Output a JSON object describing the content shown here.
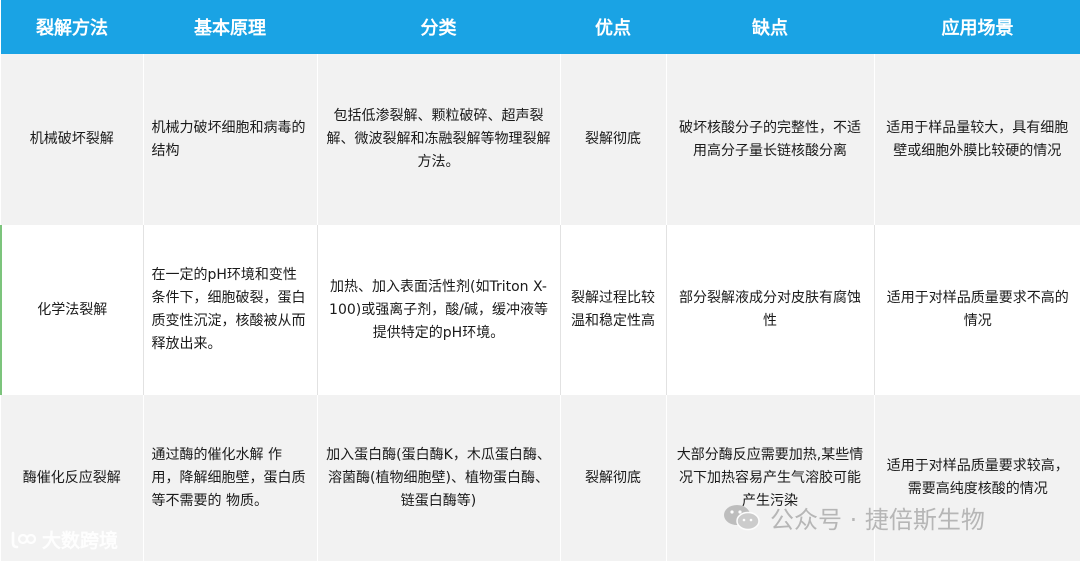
{
  "headers": [
    "裂解方法",
    "基本原理",
    "分类",
    "优点",
    "缺点",
    "应用场景"
  ],
  "rows": [
    {
      "method": "机械破坏裂解",
      "principle": "机械力破坏细胞和病毒的结构",
      "category": "包括低渗裂解、颗粒破碎、超声裂解、微波裂解和冻融裂解等物理裂解方法。",
      "pros": "裂解彻底",
      "cons": "破坏核酸分子的完整性，不适用高分子量长链核酸分离",
      "scenario": "适用于样品量较大，具有细胞壁或细胞外膜比较硬的情况"
    },
    {
      "method": "化学法裂解",
      "principle": "在一定的pH环境和变性条件下，细胞破裂，蛋白质变性沉淀，核酸被从而释放出来。",
      "category": "加热、加入表面活性剂(如Triton X-100)或强离子剂，酸/碱，缓冲液等提供特定的pH环境。",
      "pros": "裂解过程比较温和稳定性高",
      "cons": "部分裂解液成分对皮肤有腐蚀性",
      "scenario": "适用于对样品质量要求不高的情况"
    },
    {
      "method": "酶催化反应裂解",
      "principle": "通过酶的催化水解 作用，降解细胞壁，蛋白质等不需要的 物质。",
      "category": "加入蛋白酶(蛋白酶K，木瓜蛋白酶、溶菌酶(植物细胞壁)、植物蛋白酶、链蛋白酶等)",
      "pros": "裂解彻底",
      "cons": "大部分酶反应需要加热,某些情况下加热容易产生气溶胶可能产生污染",
      "scenario": "适用于对样品质量要求较高，需要高纯度核酸的情况"
    }
  ],
  "watermarks": {
    "left": "大数跨境",
    "right": "公众号 · 捷倍斯生物"
  }
}
